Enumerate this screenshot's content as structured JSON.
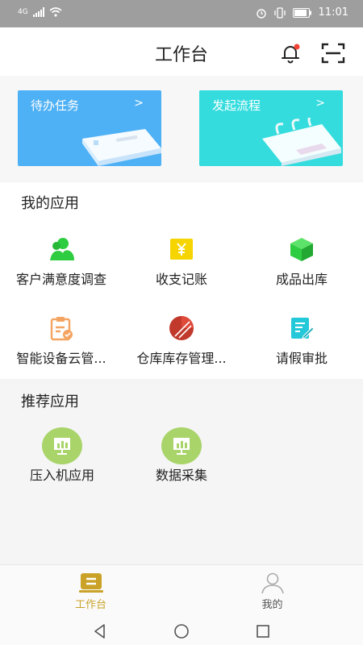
{
  "status_bar": {
    "network": "4G",
    "time": "11:01",
    "icons": [
      "signal-icon",
      "wifi-icon",
      "alarm-icon",
      "vibrate-icon",
      "battery-icon"
    ]
  },
  "header": {
    "title": "工作台",
    "icons": [
      "bell-icon",
      "scan-icon"
    ],
    "notification_dot_color": "#f44336"
  },
  "banners": [
    {
      "label": "待办任务",
      "arrow": ">",
      "color": "#4fb1f5"
    },
    {
      "label": "发起流程",
      "arrow": ">",
      "color": "#34dcde"
    }
  ],
  "my_apps": {
    "title": "我的应用",
    "items": [
      {
        "label": "客户满意度调查",
        "icon": "customer-icon",
        "color": "#2ecc40"
      },
      {
        "label": "收支记账",
        "icon": "yen-icon",
        "color": "#f5d400"
      },
      {
        "label": "成品出库",
        "icon": "box-icon",
        "color": "#2ecc40"
      },
      {
        "label": "智能设备云管...",
        "icon": "clipboard-icon",
        "color": "#f4a460"
      },
      {
        "label": "仓库库存管理...",
        "icon": "pie-chart-icon",
        "color": "#c0392b"
      },
      {
        "label": "请假审批",
        "icon": "edit-note-icon",
        "color": "#23c8d9"
      }
    ]
  },
  "recommended_apps": {
    "title": "推荐应用",
    "items": [
      {
        "label": "压入机应用",
        "icon": "monitor-icon"
      },
      {
        "label": "数据采集",
        "icon": "monitor-icon"
      }
    ],
    "color": "#a9d46a"
  },
  "tab_bar": {
    "items": [
      {
        "label": "工作台",
        "icon": "workbench-icon",
        "active": true
      },
      {
        "label": "我的",
        "icon": "user-icon",
        "active": false
      }
    ],
    "active_color": "#c9a227"
  },
  "nav_bar": {
    "icons": [
      "back-icon",
      "home-icon",
      "recents-icon"
    ]
  }
}
